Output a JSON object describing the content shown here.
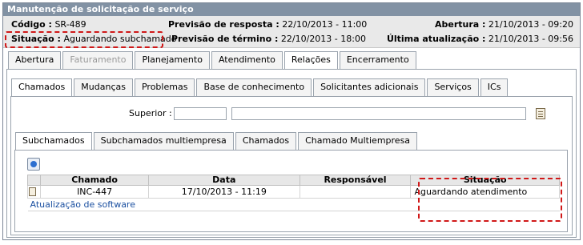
{
  "window": {
    "title": "Manutenção de solicitação de serviço"
  },
  "info": {
    "codigo_label": "Código :",
    "codigo_value": "SR-489",
    "situacao_label": "Situação :",
    "situacao_value": "Aguardando subchamado",
    "previsao_resposta_label": "Previsão de resposta :",
    "previsao_resposta_value": "22/10/2013 - 11:00",
    "previsao_termino_label": "Previsão de término :",
    "previsao_termino_value": "22/10/2013 - 18:00",
    "abertura_label": "Abertura :",
    "abertura_value": "21/10/2013 - 09:20",
    "ultima_label": "Última atualização :",
    "ultima_value": "21/10/2013 - 09:56"
  },
  "main_tabs": [
    {
      "label": "Abertura"
    },
    {
      "label": "Faturamento"
    },
    {
      "label": "Planejamento"
    },
    {
      "label": "Atendimento"
    },
    {
      "label": "Relações"
    },
    {
      "label": "Encerramento"
    }
  ],
  "sub_tabs": [
    {
      "label": "Chamados"
    },
    {
      "label": "Mudanças"
    },
    {
      "label": "Problemas"
    },
    {
      "label": "Base de conhecimento"
    },
    {
      "label": "Solicitantes adicionais"
    },
    {
      "label": "Serviços"
    },
    {
      "label": "ICs"
    }
  ],
  "superior": {
    "label": "Superior :",
    "code_value": "",
    "desc_value": ""
  },
  "inner_tabs": [
    {
      "label": "Subchamados"
    },
    {
      "label": "Subchamados multiempresa"
    },
    {
      "label": "Chamados"
    },
    {
      "label": "Chamado Multiempresa"
    }
  ],
  "grid": {
    "headers": [
      "Chamado",
      "Data",
      "Responsável",
      "Situação"
    ],
    "rows": [
      {
        "chamado": "INC-447",
        "data": "17/10/2013 - 11:19",
        "responsavel": "",
        "situacao": "Aguardando atendimento",
        "descricao": "Atualização de software"
      }
    ]
  },
  "colors": {
    "titlebar": "#8292a4",
    "highlight": "#d01818",
    "link": "#1a4fa0"
  }
}
